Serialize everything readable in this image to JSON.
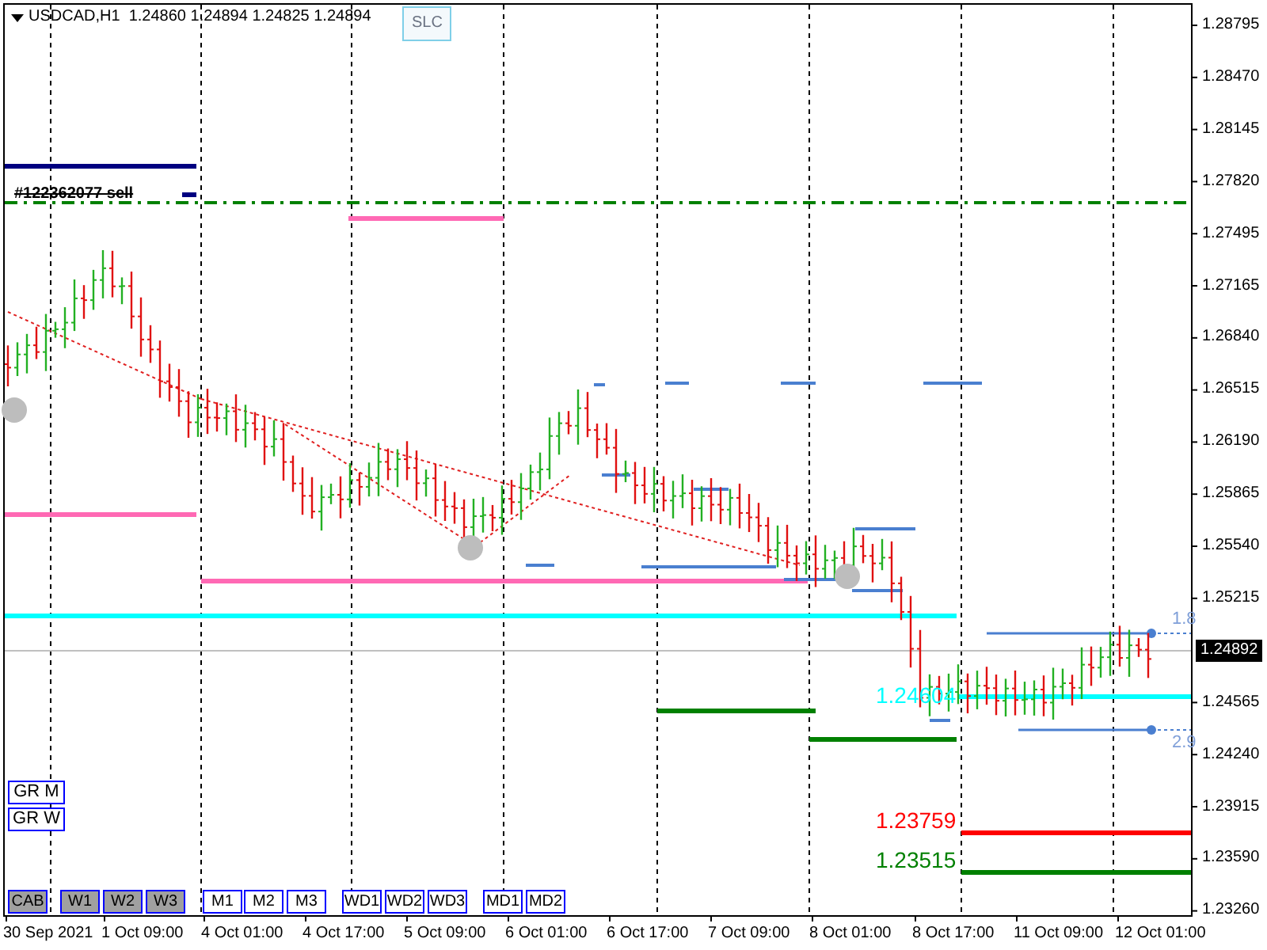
{
  "chart": {
    "header": "USDCAD,H1  1.24860 1.24894 1.24825 1.24894",
    "order_label": "#122362077 sell",
    "level_labels": [
      {
        "text": "1.24604",
        "color": "#00ffff"
      },
      {
        "text": "1.23759",
        "color": "#ff0000"
      },
      {
        "text": "1.23515",
        "color": "#008000"
      }
    ],
    "ray_labels": [
      "1.8",
      "2.9"
    ],
    "price_axis": [
      "1.28795",
      "1.28470",
      "1.28145",
      "1.27820",
      "1.27495",
      "1.27165",
      "1.26840",
      "1.26515",
      "1.26190",
      "1.25865",
      "1.25540",
      "1.25215",
      "1.24565",
      "1.24240",
      "1.23915",
      "1.23590",
      "1.23260"
    ],
    "current_price": "1.24892",
    "time_axis": [
      "30 Sep 2021",
      "1 Oct 09:00",
      "4 Oct 01:00",
      "4 Oct 17:00",
      "5 Oct 09:00",
      "6 Oct 01:00",
      "6 Oct 17:00",
      "7 Oct 09:00",
      "8 Oct 01:00",
      "8 Oct 17:00",
      "11 Oct 09:00",
      "12 Oct 01:00"
    ]
  },
  "top_buttons": [
    {
      "label": "SLC"
    }
  ],
  "side_buttons": [
    {
      "label": "GR M"
    },
    {
      "label": "GR W"
    }
  ],
  "bottom_buttons": [
    {
      "label": "CAB",
      "selected": true
    },
    {
      "label": "W1",
      "selected": true
    },
    {
      "label": "W2",
      "selected": true
    },
    {
      "label": "W3",
      "selected": true
    },
    {
      "label": "M1",
      "selected": false
    },
    {
      "label": "M2",
      "selected": false
    },
    {
      "label": "M3",
      "selected": false
    },
    {
      "label": "WD1",
      "selected": false
    },
    {
      "label": "WD2",
      "selected": false
    },
    {
      "label": "WD3",
      "selected": false
    },
    {
      "label": "MD1",
      "selected": false
    },
    {
      "label": "MD2",
      "selected": false
    }
  ]
}
